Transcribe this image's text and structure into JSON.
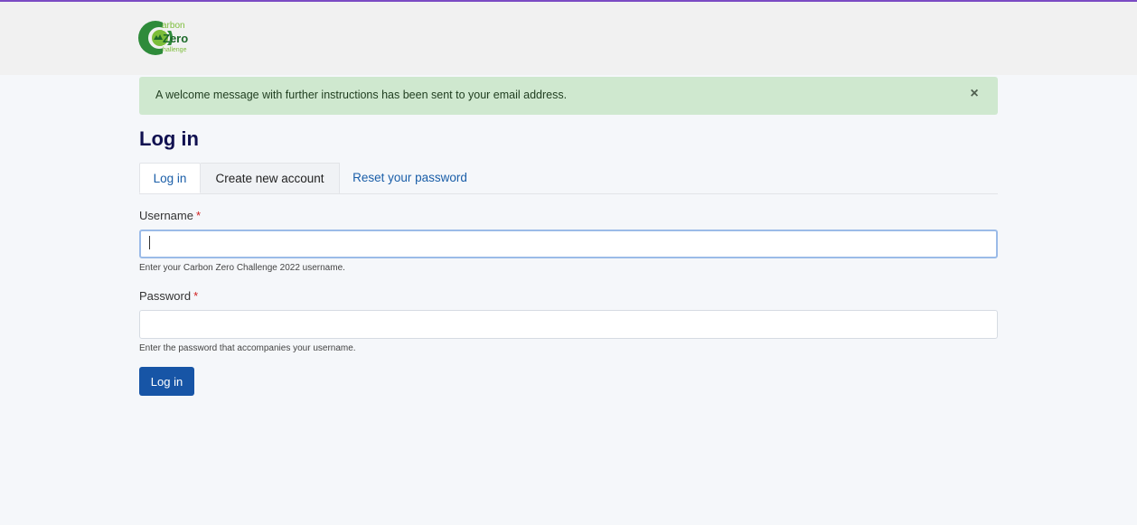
{
  "header": {
    "logo": {
      "line1": "arbon",
      "line2": "Zero",
      "line3": "hallenge",
      "colors": {
        "ring": "#2e8b3a",
        "inner": "#7cbd3a",
        "dark": "#1d6a2a"
      }
    }
  },
  "alert": {
    "message": "A welcome message with further instructions has been sent to your email address.",
    "close_icon": "×"
  },
  "page_title": "Log in",
  "tabs": [
    {
      "label": "Log in",
      "active": true
    },
    {
      "label": "Create new account",
      "active": false
    },
    {
      "label": "Reset your password",
      "active": false
    }
  ],
  "form": {
    "username": {
      "label": "Username",
      "required_mark": "*",
      "value": "",
      "help": "Enter your Carbon Zero Challenge 2022 username."
    },
    "password": {
      "label": "Password",
      "required_mark": "*",
      "value": "",
      "help": "Enter the password that accompanies your username."
    },
    "submit_label": "Log in"
  },
  "colors": {
    "accent": "#1755a6",
    "top_border": "#7b4bc4",
    "alert_bg": "#cfe8cf",
    "title": "#101050",
    "required": "#d02020"
  }
}
